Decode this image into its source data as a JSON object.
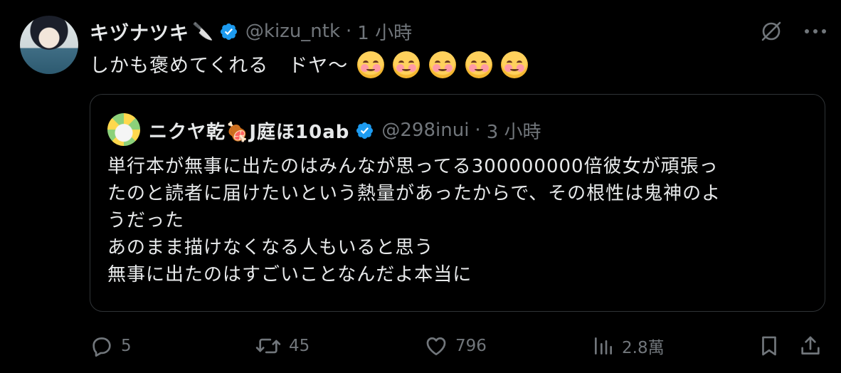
{
  "author": {
    "name": "キヅナツキ",
    "emoji": "🔪",
    "handle": "@kizu_ntk",
    "separator": "·",
    "time": "1 小時"
  },
  "tweet": {
    "text": "しかも褒めてくれる　ドヤ〜"
  },
  "quoted": {
    "name": "ニクヤ乾🍖J庭ほ10ab",
    "handle": "@298inui",
    "separator": "·",
    "time": "3 小時",
    "lines": [
      "単行本が無事に出たのはみんなが思ってる300000000倍彼女が頑張っ",
      "たのと読者に届けたいという熱量があったからで、その根性は鬼神のよ",
      "うだった",
      "あのまま描けなくなる人もいると思う",
      "無事に出たのはすごいことなんだよ本当に"
    ]
  },
  "stats": {
    "replies": "5",
    "reposts": "45",
    "likes": "796",
    "views": "2.8萬"
  },
  "colors": {
    "background": "#000000",
    "text": "#e7e9ea",
    "muted": "#71767b",
    "verified": "#1d9bf0",
    "border": "#2f3336"
  },
  "icons": {
    "verified": "verified-badge-icon",
    "grok": "grok-slash-icon",
    "more": "more-dots-icon",
    "reply": "reply-icon",
    "repost": "repost-icon",
    "like": "heart-icon",
    "views": "views-bar-chart-icon",
    "bookmark": "bookmark-icon",
    "share": "share-icon"
  }
}
